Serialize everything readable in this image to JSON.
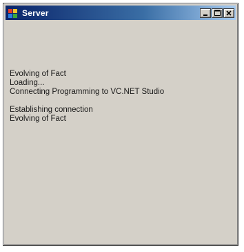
{
  "window": {
    "title": "Server",
    "controls": {
      "minimize_icon": "minimize-icon",
      "maximize_icon": "maximize-icon",
      "close_icon": "close-icon"
    }
  },
  "content": {
    "lines": [
      "Evolving of Fact",
      "Loading...",
      "Connecting Programming to VC.NET Studio",
      "Establishing connection",
      "Evolving of Fact"
    ]
  },
  "colors": {
    "titlebar_start": "#0a246a",
    "titlebar_end": "#a6caf0",
    "window_face": "#d4d0c8"
  }
}
